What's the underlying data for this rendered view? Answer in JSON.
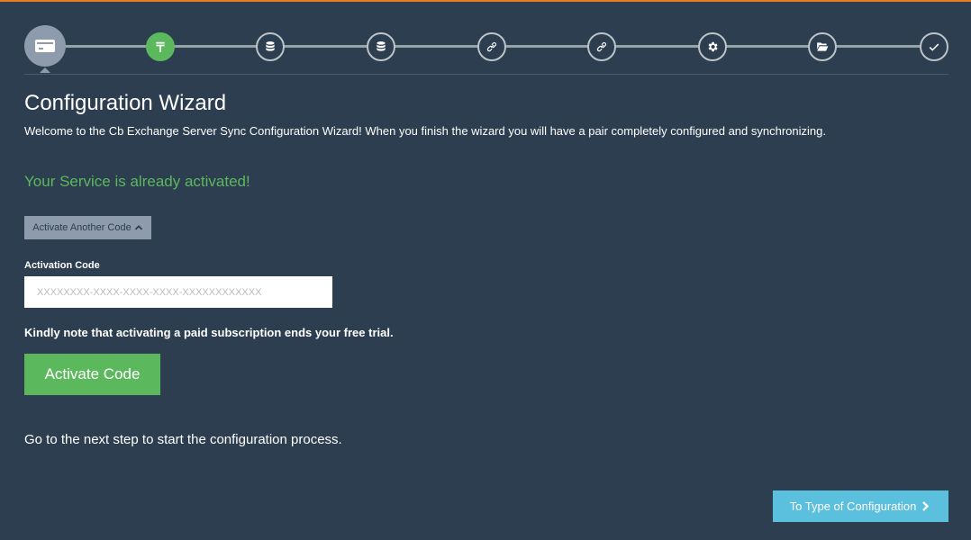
{
  "wizard": {
    "title": "Configuration Wizard",
    "welcome": "Welcome to the Cb Exchange Server Sync Configuration Wizard! When you finish the wizard you will have a pair completely configured and synchronizing."
  },
  "steps": [
    {
      "icon": "credit-card-icon",
      "state": "current"
    },
    {
      "icon": "tenge-icon",
      "state": "done"
    },
    {
      "icon": "database-icon",
      "state": "pending"
    },
    {
      "icon": "database-icon",
      "state": "pending"
    },
    {
      "icon": "link-icon",
      "state": "pending"
    },
    {
      "icon": "link-icon",
      "state": "pending"
    },
    {
      "icon": "gear-icon",
      "state": "pending"
    },
    {
      "icon": "folder-open-icon",
      "state": "pending"
    },
    {
      "icon": "check-icon",
      "state": "pending"
    }
  ],
  "activation": {
    "status": "Your Service is already activated!",
    "toggle_label": "Activate Another Code",
    "field_label": "Activation Code",
    "placeholder": "XXXXXXXX-XXXX-XXXX-XXXX-XXXXXXXXXXXX",
    "note": "Kindly note that activating a paid subscription ends your free trial.",
    "button_label": "Activate Code"
  },
  "footer": {
    "next_text": "Go to the next step to start the configuration process.",
    "next_button_label": "To Type of Configuration"
  },
  "colors": {
    "background": "#2c3e50",
    "accent_green": "#5cb85c",
    "accent_blue": "#5bc0de",
    "muted": "#8d9bac",
    "top_border": "#e67e22"
  }
}
